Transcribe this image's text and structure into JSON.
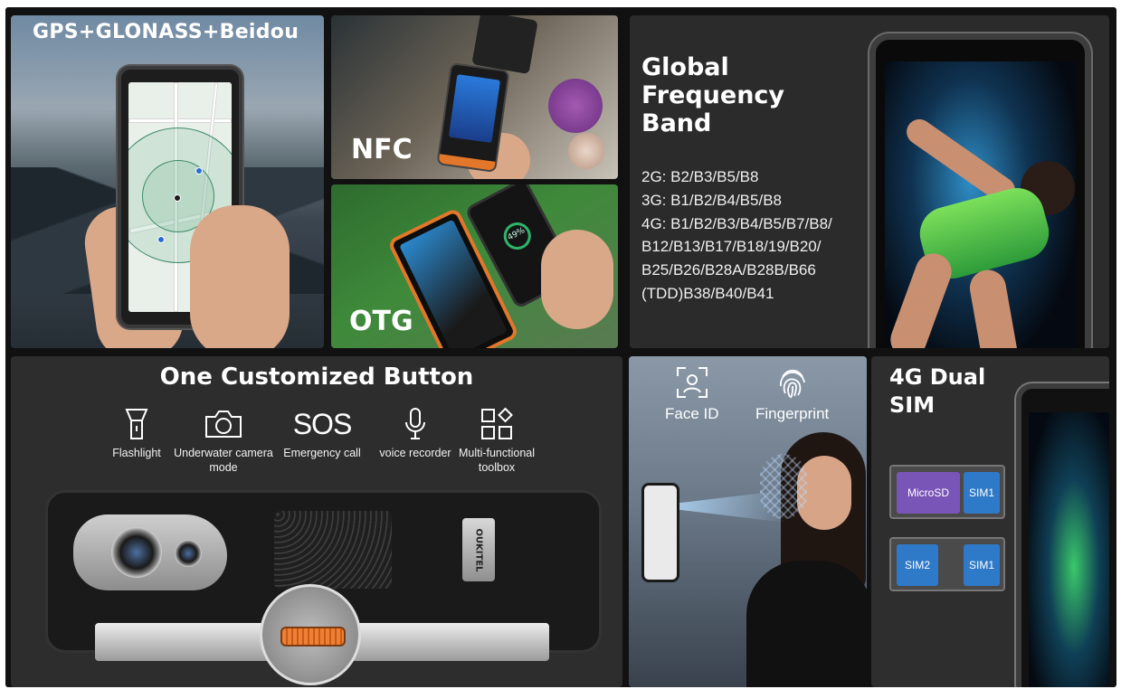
{
  "gps": {
    "title": "GPS+GLONASS+Beidou"
  },
  "nfc": {
    "label": "NFC"
  },
  "otg": {
    "label": "OTG",
    "battery_text": "49%"
  },
  "frequency": {
    "title_lines": [
      "Global",
      "Frequency",
      "Band"
    ],
    "bands": [
      "2G: B2/B3/B5/B8",
      "3G: B1/B2/B4/B5/B8",
      "4G: B1/B2/B3/B4/B5/B7/B8/",
      "B12/B13/B17/B18/19/B20/",
      "B25/B26/B28A/B28B/B66",
      "(TDD)B38/B40/B41"
    ]
  },
  "custom_button": {
    "title": "One Customized Button",
    "features": [
      {
        "icon": "flashlight-icon",
        "label": "Flashlight"
      },
      {
        "icon": "camera-icon",
        "label": "Underwater camera mode"
      },
      {
        "icon": "sos-icon",
        "icon_text": "SOS",
        "label": "Emergency call"
      },
      {
        "icon": "microphone-icon",
        "label": "voice recorder"
      },
      {
        "icon": "toolbox-icon",
        "label": "Multi-functional toolbox"
      }
    ],
    "brand": "OUKITEL"
  },
  "biometrics": {
    "face_id": "Face ID",
    "fingerprint": "Fingerprint"
  },
  "dual_sim": {
    "title_lines": [
      "4G Dual",
      "SIM"
    ],
    "tray1": [
      "MicroSD",
      "SIM1"
    ],
    "tray2": [
      "SIM2",
      "SIM1"
    ]
  },
  "colors": {
    "accent_orange": "#e2772a",
    "panel_dark": "#2d2d2d",
    "background": "#111111"
  }
}
